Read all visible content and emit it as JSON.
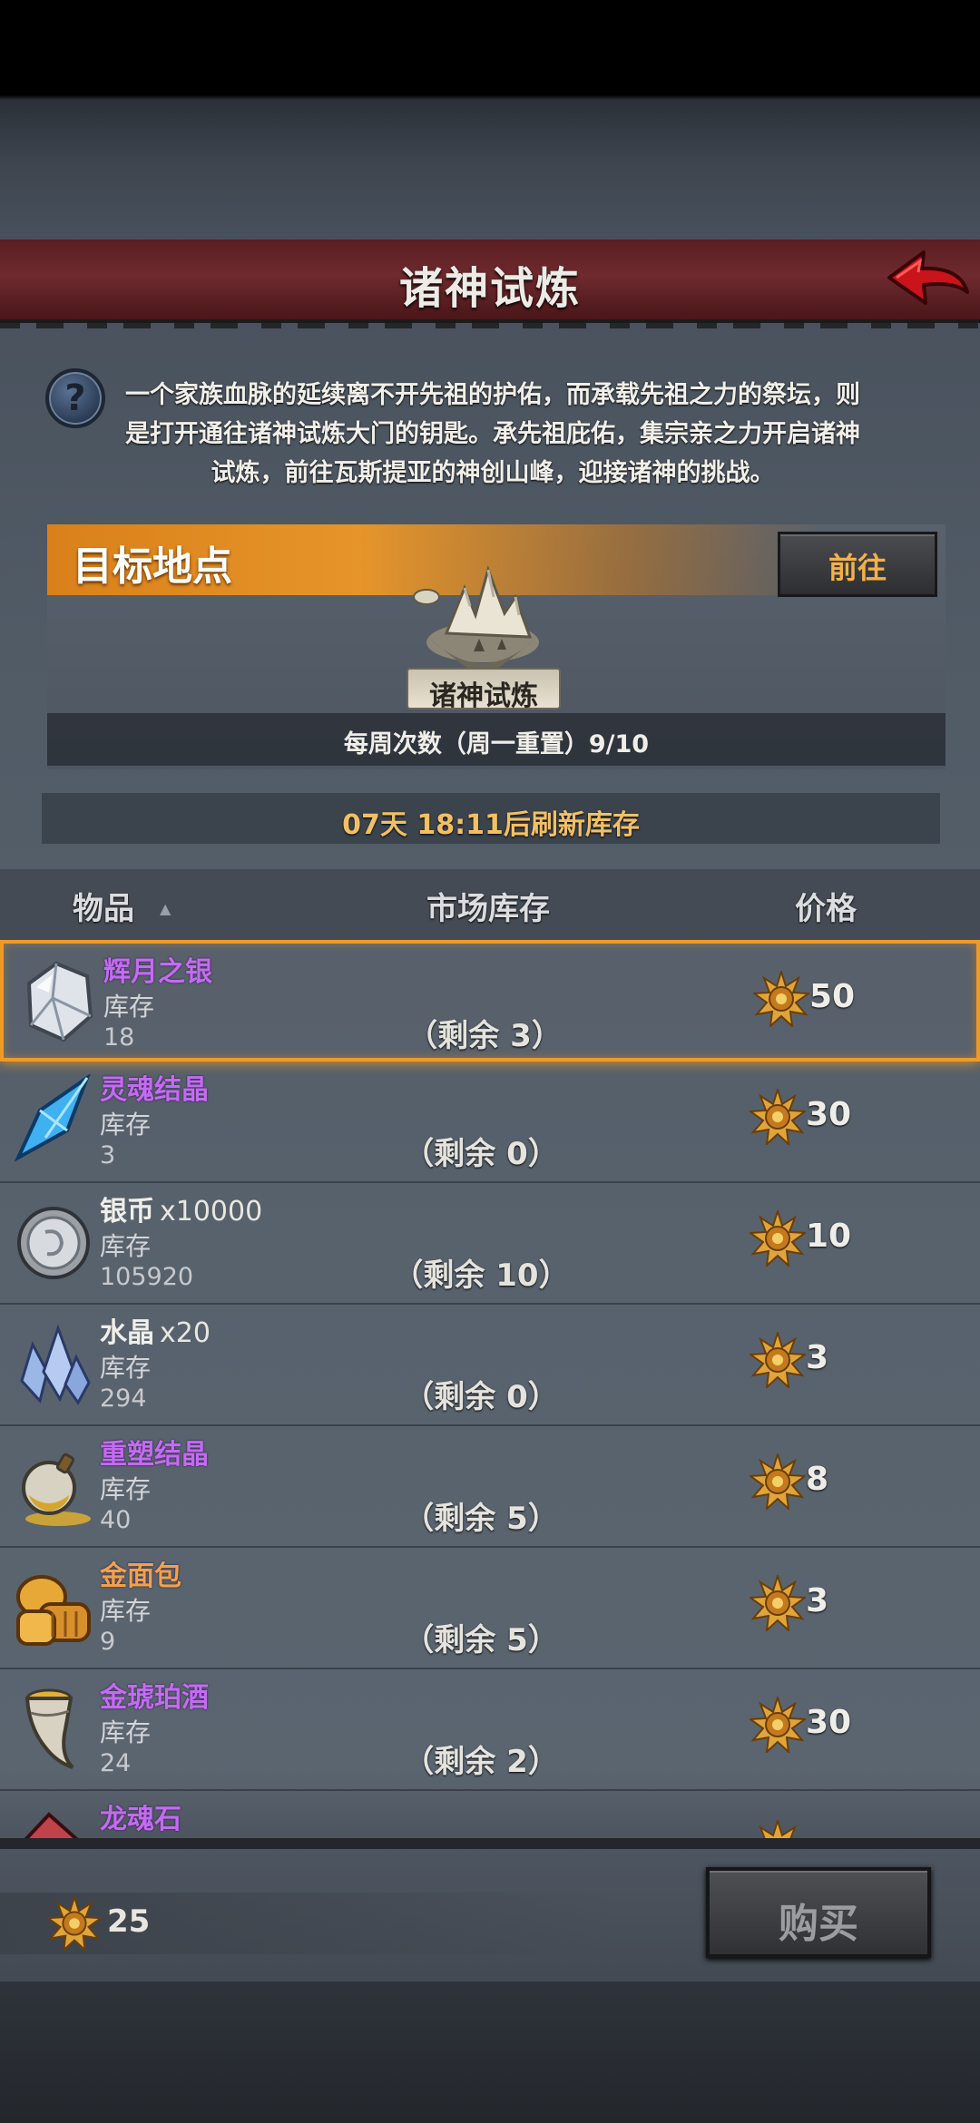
{
  "header": {
    "title": "诸神试炼"
  },
  "help": {
    "text_lines": [
      "一个家族血脉的延续离不开先祖的护佑，而承载先祖之力的祭坛，则",
      "是打开通往诸神试炼大门的钥匙。承先祖庇佑，集宗亲之力开启诸神",
      "试炼，前往瓦斯提亚的神创山峰，迎接诸神的挑战。"
    ]
  },
  "target": {
    "header": "目标地点",
    "go_label": "前往",
    "location_name": "诸神试炼",
    "weekly": "每周次数（周一重置）9/10"
  },
  "refresh": "07天 18:11后刷新库存",
  "table": {
    "col_item": "物品",
    "col_stock": "市场库存",
    "col_price": "价格",
    "stock_label": "库存"
  },
  "items": [
    {
      "name": "辉月之银",
      "qty": "",
      "stock": "18",
      "remain": "（剩余 3）",
      "price": "50",
      "color": "purple",
      "icon": "silver-ore-icon",
      "selected": true
    },
    {
      "name": "灵魂结晶",
      "qty": "",
      "stock": "3",
      "remain": "（剩余 0）",
      "price": "30",
      "color": "purple",
      "icon": "soul-crystal-icon",
      "selected": false
    },
    {
      "name": "银币",
      "qty": "x10000",
      "stock": "105920",
      "remain": "（剩余 10）",
      "price": "10",
      "color": "white",
      "icon": "silver-coin-icon",
      "selected": false
    },
    {
      "name": "水晶",
      "qty": "x20",
      "stock": "294",
      "remain": "（剩余 0）",
      "price": "3",
      "color": "white",
      "icon": "crystal-icon",
      "selected": false
    },
    {
      "name": "重塑结晶",
      "qty": "",
      "stock": "40",
      "remain": "（剩余 5）",
      "price": "8",
      "color": "purple",
      "icon": "reforge-crystal-icon",
      "selected": false
    },
    {
      "name": "金面包",
      "qty": "",
      "stock": "9",
      "remain": "（剩余 5）",
      "price": "3",
      "color": "purple",
      "icon": "golden-bread-icon",
      "selected": false
    },
    {
      "name": "金琥珀酒",
      "qty": "",
      "stock": "24",
      "remain": "（剩余 2）",
      "price": "30",
      "color": "purple",
      "icon": "amber-wine-icon",
      "selected": false
    },
    {
      "name": "龙魂石",
      "qty": "",
      "stock": "",
      "remain": "",
      "price": "",
      "color": "purple",
      "icon": "dragon-soul-stone-icon",
      "selected": false
    }
  ],
  "footer": {
    "balance": "25",
    "buy_label": "购买"
  },
  "colors": {
    "accent_orange": "#f09a26",
    "item_purple": "#c36bf2",
    "title_red": "#6e2a2e",
    "gold_text": "#f2c064"
  }
}
